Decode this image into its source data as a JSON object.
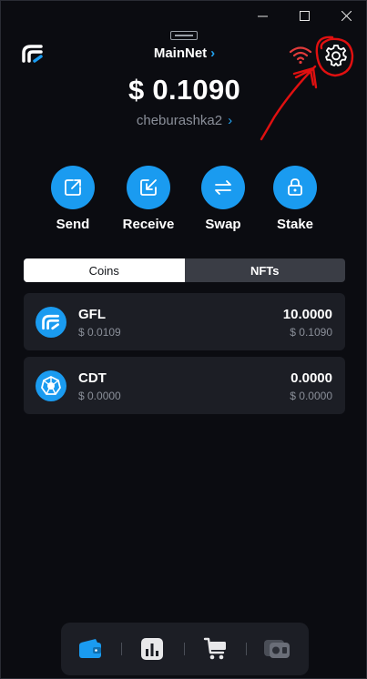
{
  "window": {
    "minimize_glyph": "—",
    "maximize_glyph": "☐",
    "close_glyph": "✕"
  },
  "header": {
    "network_label": "MainNet",
    "network_chevron": "›",
    "balance": "$ 0.1090",
    "account_name": "cheburashka2",
    "account_chevron": "›"
  },
  "colors": {
    "accent": "#1a9bf0",
    "background": "#0b0c11",
    "card": "#1c1e25",
    "wifi": "#e23b3b",
    "annotation": "#e01010"
  },
  "icons": {
    "logo": "gfl-logo-icon",
    "wifi": "wifi-icon",
    "settings": "gear-icon",
    "send": "send-icon",
    "receive": "receive-icon",
    "swap": "swap-icon",
    "stake": "lock-icon",
    "wallet": "wallet-icon",
    "stats": "bar-chart-icon",
    "market": "cart-icon",
    "nft": "nft-icon"
  },
  "actions": [
    {
      "label": "Send"
    },
    {
      "label": "Receive"
    },
    {
      "label": "Swap"
    },
    {
      "label": "Stake"
    }
  ],
  "tabs": [
    {
      "label": "Coins",
      "active": true
    },
    {
      "label": "NFTs",
      "active": false
    }
  ],
  "coins": [
    {
      "symbol": "GFL",
      "price": "$ 0.0109",
      "amount": "10.0000",
      "value": "$ 0.1090"
    },
    {
      "symbol": "CDT",
      "price": "$ 0.0000",
      "amount": "0.0000",
      "value": "$ 0.0000"
    }
  ],
  "bottom_nav": {
    "sep": "|"
  }
}
